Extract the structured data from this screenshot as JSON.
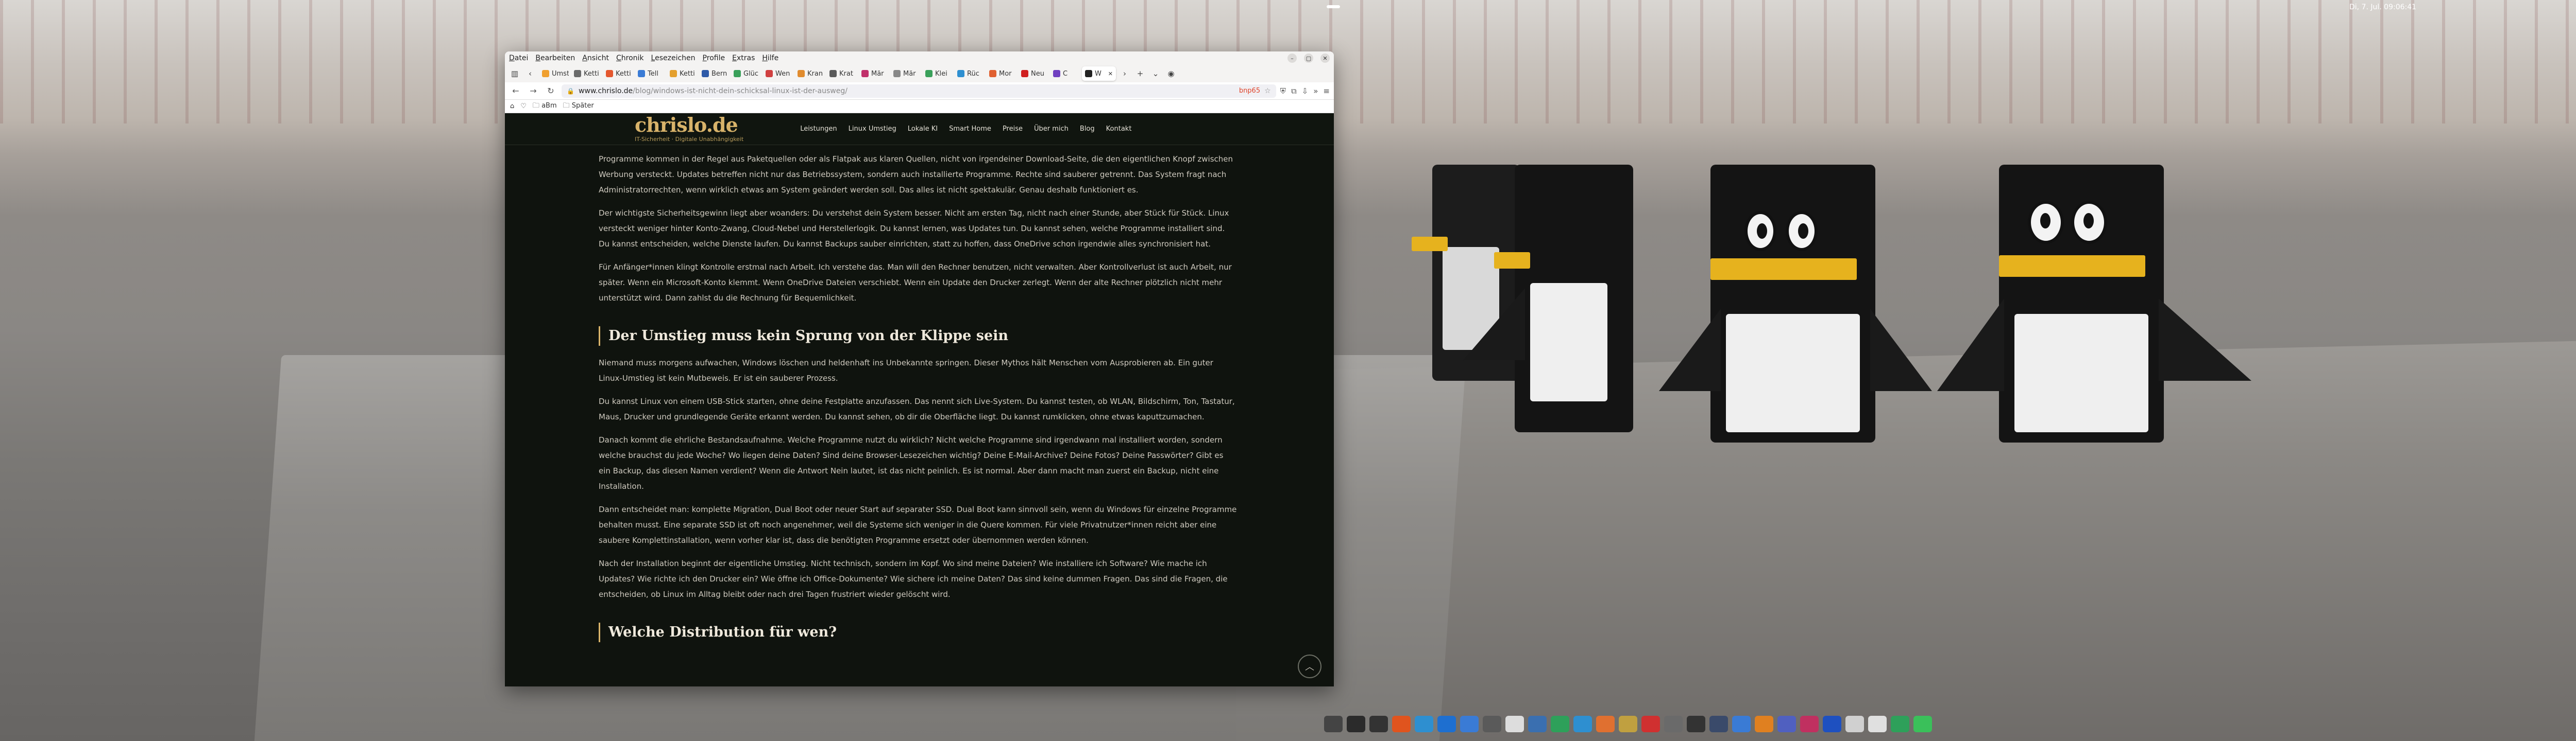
{
  "system": {
    "clock": "Di, 7. Jul. 09:06:41",
    "tray_icons": [
      "speaker-icon",
      "power-icon"
    ]
  },
  "browser": {
    "menu": [
      "Datei",
      "Bearbeiten",
      "Ansicht",
      "Chronik",
      "Lesezeichen",
      "Profile",
      "Extras",
      "Hilfe"
    ],
    "tabs": [
      {
        "label": "Umst",
        "color": "#f0a030"
      },
      {
        "label": "Ketti",
        "color": "#6a6a6a"
      },
      {
        "label": "Ketti",
        "color": "#e4572e"
      },
      {
        "label": "Tell",
        "color": "#3a7bd5"
      },
      {
        "label": "Ketti",
        "color": "#e4a02e"
      },
      {
        "label": "Bern",
        "color": "#2e5aa8"
      },
      {
        "label": "Glüc",
        "color": "#3aa05a"
      },
      {
        "label": "Wen",
        "color": "#d04040"
      },
      {
        "label": "Kran",
        "color": "#e08b2e"
      },
      {
        "label": "Krat",
        "color": "#5a5a5a"
      },
      {
        "label": "Mär",
        "color": "#c0306a"
      },
      {
        "label": "Mär",
        "color": "#888"
      },
      {
        "label": "Klei",
        "color": "#3aa05a"
      },
      {
        "label": "Rüc",
        "color": "#2e8fd0"
      },
      {
        "label": "Mor",
        "color": "#e06030"
      },
      {
        "label": "Neu",
        "color": "#d02020"
      },
      {
        "label": "C",
        "color": "#7040c0"
      },
      {
        "label": "W",
        "color": "#222"
      }
    ],
    "url_host": "www.chrislo.de",
    "url_path": "/blog/windows-ist-nicht-dein-schicksal-linux-ist-der-ausweg/",
    "addon_text": "bnp65",
    "bookmarks": [
      "aBm",
      "Später"
    ]
  },
  "site": {
    "logo": "chrislo.de",
    "tagline": "IT-Sicherheit · Digitale Unabhängigkeit",
    "nav": [
      "Leistungen",
      "Linux Umstieg",
      "Lokale KI",
      "Smart Home",
      "Preise",
      "Über mich",
      "Blog",
      "Kontakt"
    ]
  },
  "article": {
    "p1": "Programme kommen in der Regel aus Paketquellen oder als Flatpak aus klaren Quellen, nicht von irgendeiner Download-Seite, die den eigentlichen Knopf zwischen Werbung versteckt. Updates betreffen nicht nur das Betriebssystem, sondern auch installierte Programme. Rechte sind sauberer getrennt. Das System fragt nach Administratorrechten, wenn wirklich etwas am System geändert werden soll. Das alles ist nicht spektakulär. Genau deshalb funktioniert es.",
    "p2": "Der wichtigste Sicherheitsgewinn liegt aber woanders: Du verstehst dein System besser. Nicht am ersten Tag, nicht nach einer Stunde, aber Stück für Stück. Linux versteckt weniger hinter Konto-Zwang, Cloud-Nebel und Herstellerlogik. Du kannst lernen, was Updates tun. Du kannst sehen, welche Programme installiert sind. Du kannst entscheiden, welche Dienste laufen. Du kannst Backups sauber einrichten, statt zu hoffen, dass OneDrive schon irgendwie alles synchronisiert hat.",
    "p3": "Für Anfänger*innen klingt Kontrolle erstmal nach Arbeit. Ich verstehe das. Man will den Rechner benutzen, nicht verwalten. Aber Kontrollverlust ist auch Arbeit, nur später. Wenn ein Microsoft-Konto klemmt. Wenn OneDrive Dateien verschiebt. Wenn ein Update den Drucker zerlegt. Wenn der alte Rechner plötzlich nicht mehr unterstützt wird. Dann zahlst du die Rechnung für Bequemlichkeit.",
    "h2a": "Der Umstieg muss kein Sprung von der Klippe sein",
    "p4": "Niemand muss morgens aufwachen, Windows löschen und heldenhaft ins Unbekannte springen. Dieser Mythos hält Menschen vom Ausprobieren ab. Ein guter Linux-Umstieg ist kein Mutbeweis. Er ist ein sauberer Prozess.",
    "p5": "Du kannst Linux von einem USB-Stick starten, ohne deine Festplatte anzufassen. Das nennt sich Live-System. Du kannst testen, ob WLAN, Bildschirm, Ton, Tastatur, Maus, Drucker und grundlegende Geräte erkannt werden. Du kannst sehen, ob dir die Oberfläche liegt. Du kannst rumklicken, ohne etwas kaputtzumachen.",
    "p6": "Danach kommt die ehrliche Bestandsaufnahme. Welche Programme nutzt du wirklich? Nicht welche Programme sind irgendwann mal installiert worden, sondern welche brauchst du jede Woche? Wo liegen deine Daten? Sind deine Browser-Lesezeichen wichtig? Deine E-Mail-Archive? Deine Fotos? Deine Passwörter? Gibt es ein Backup, das diesen Namen verdient? Wenn die Antwort Nein lautet, ist das nicht peinlich. Es ist normal. Aber dann macht man zuerst ein Backup, nicht eine Installation.",
    "p7": "Dann entscheidet man: komplette Migration, Dual Boot oder neuer Start auf separater SSD. Dual Boot kann sinnvoll sein, wenn du Windows für einzelne Programme behalten musst. Eine separate SSD ist oft noch angenehmer, weil die Systeme sich weniger in die Quere kommen. Für viele Privatnutzer*innen reicht aber eine saubere Komplettinstallation, wenn vorher klar ist, dass die benötigten Programme ersetzt oder übernommen werden können.",
    "p8": "Nach der Installation beginnt der eigentliche Umstieg. Nicht technisch, sondern im Kopf. Wo sind meine Dateien? Wie installiere ich Software? Wie mache ich Updates? Wie richte ich den Drucker ein? Wie öffne ich Office-Dokumente? Wie sichere ich meine Daten? Das sind keine dummen Fragen. Das sind die Fragen, die entscheiden, ob Linux im Alltag bleibt oder nach drei Tagen frustriert wieder gelöscht wird.",
    "h2b": "Welche Distribution für wen?"
  },
  "dock": [
    {
      "name": "app-grid-icon",
      "color": "#444"
    },
    {
      "name": "terminal-icon",
      "color": "#2b2b2b"
    },
    {
      "name": "window-icon",
      "color": "#333"
    },
    {
      "name": "firefox-icon",
      "color": "#e0541e"
    },
    {
      "name": "browser-icon",
      "color": "#2e8fd0"
    },
    {
      "name": "thunderbird-icon",
      "color": "#1e6fd0"
    },
    {
      "name": "settings-icon",
      "color": "#3a7bd5"
    },
    {
      "name": "files-icon",
      "color": "#5a5a5a"
    },
    {
      "name": "document-icon",
      "color": "#ddd"
    },
    {
      "name": "folder-icon",
      "color": "#3a6fb0"
    },
    {
      "name": "spreadsheet-icon",
      "color": "#2ea05a"
    },
    {
      "name": "calendar-icon",
      "color": "#2e8fd0"
    },
    {
      "name": "presentation-icon",
      "color": "#e07030"
    },
    {
      "name": "archive-icon",
      "color": "#c0a040"
    },
    {
      "name": "pdf-icon",
      "color": "#d03030"
    },
    {
      "name": "gimp-icon",
      "color": "#6a6a6a"
    },
    {
      "name": "media-icon",
      "color": "#333"
    },
    {
      "name": "monitor-icon",
      "color": "#3a4a6a"
    },
    {
      "name": "chart-icon",
      "color": "#3a7bd5"
    },
    {
      "name": "vlc-icon",
      "color": "#e08020"
    },
    {
      "name": "image-icon",
      "color": "#5060c0"
    },
    {
      "name": "disk-icon",
      "color": "#c03060"
    },
    {
      "name": "ki-icon",
      "color": "#1e50c0"
    },
    {
      "name": "sound-icon",
      "color": "#d0d0d0"
    },
    {
      "name": "gear-icon",
      "color": "#e0e0e0"
    },
    {
      "name": "download-icon",
      "color": "#2ea05a"
    },
    {
      "name": "star-icon",
      "color": "#3ac05a"
    }
  ]
}
